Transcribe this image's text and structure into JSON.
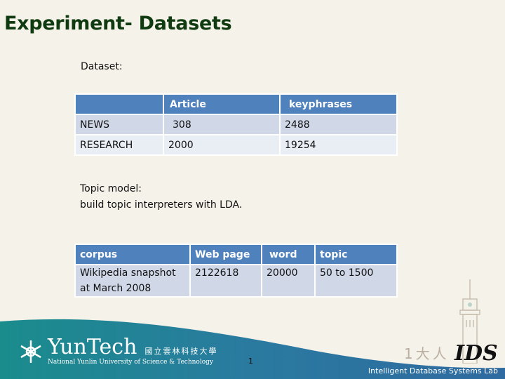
{
  "slide": {
    "title": "Experiment- Datasets",
    "dataset_label": "Dataset:",
    "topic_model_line1": "Topic model:",
    "topic_model_line2": "build topic interpreters with LDA.",
    "page_number": "1"
  },
  "dataset_table": {
    "headers": [
      "",
      "Article",
      "keyphrases"
    ],
    "rows": [
      [
        "NEWS",
        "308",
        "2488"
      ],
      [
        "RESEARCH",
        "2000",
        "19254"
      ]
    ]
  },
  "corpus_table": {
    "headers": [
      "corpus",
      "Web page",
      "word",
      "topic"
    ],
    "rows": [
      [
        "Wikipedia snapshot at March 2008",
        "2122618",
        "20000",
        "50 to 1500"
      ]
    ]
  },
  "footer": {
    "logo_name": "YunTech",
    "logo_chinese": "國立雲林科技大學",
    "logo_subtitle": "National Yunlin University of Science & Technology",
    "lab_logo": "IDS",
    "lab_name": "Intelligent Database Systems Lab"
  },
  "colors": {
    "title": "#103a10",
    "table_header": "#4f81bd",
    "table_row_dark": "#d0d8e8",
    "table_row_light": "#e9edf4",
    "footer_teal": "#1a8c8c",
    "footer_blue": "#2f6aa0"
  }
}
